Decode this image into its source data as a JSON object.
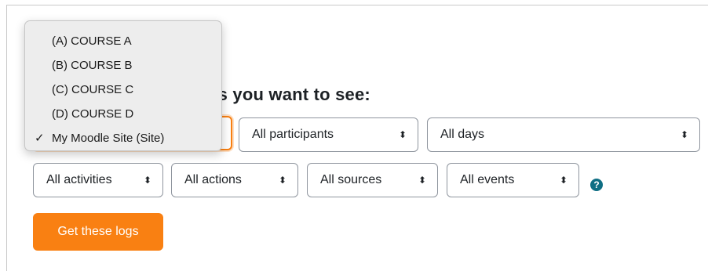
{
  "heading": {
    "text": "gs you want to see:"
  },
  "course_select": {
    "options": [
      "(A) COURSE A",
      "(B) COURSE B",
      "(C) COURSE C",
      "(D) COURSE D",
      "My Moodle Site (Site)"
    ],
    "selected_index": 4,
    "check_mark": "✓"
  },
  "filters": {
    "participants": "All participants",
    "days": "All days",
    "activities": "All activities",
    "actions": "All actions",
    "sources": "All sources",
    "events": "All events"
  },
  "select_arrow_glyph": "⬍",
  "help_icon": {
    "glyph": "?",
    "icon": "help-icon"
  },
  "submit_button": {
    "label": "Get these logs"
  },
  "colors": {
    "accent": "#f98012",
    "help": "#0f6e84",
    "text": "#1d2125"
  }
}
